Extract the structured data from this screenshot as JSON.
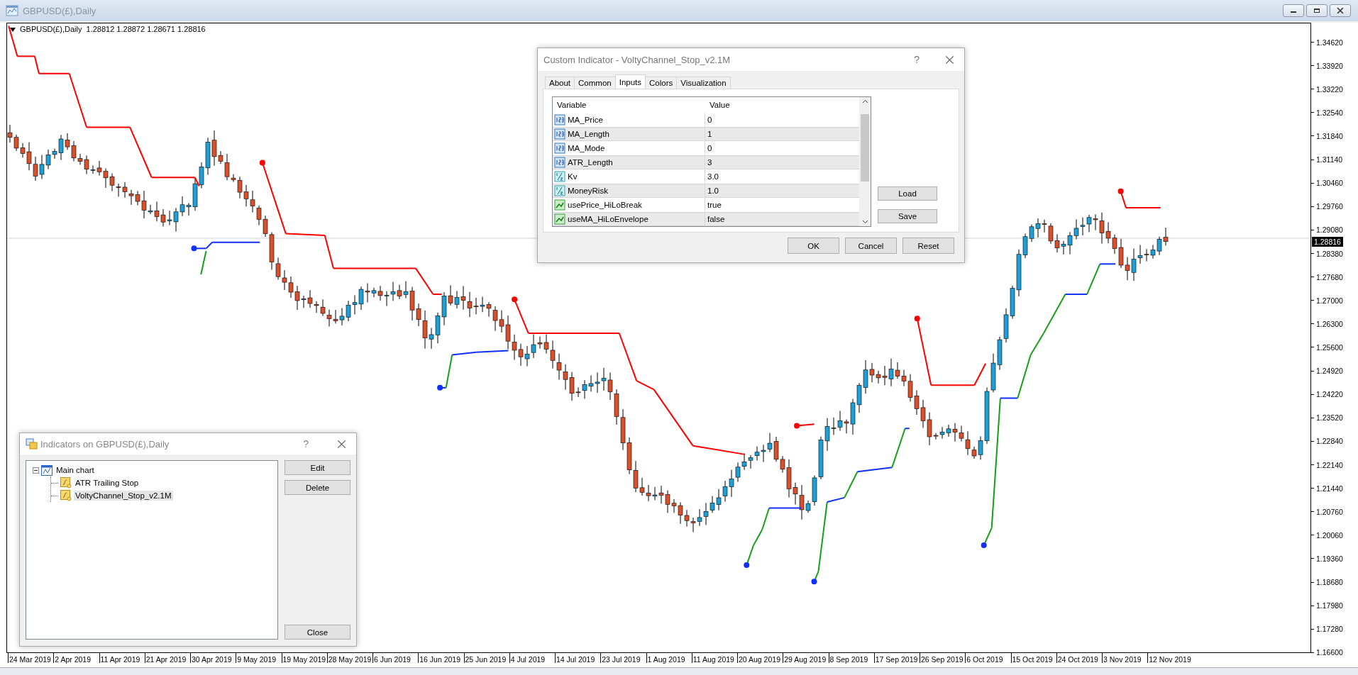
{
  "window": {
    "title": "GBPUSD(£),Daily"
  },
  "chart": {
    "header": "GBPUSD(£),Daily",
    "ohlc": [
      "1.28812",
      "1.28872",
      "1.28671",
      "1.28816"
    ],
    "price_ticks": [
      "1.34620",
      "1.33920",
      "1.33220",
      "1.32540",
      "1.31840",
      "1.31140",
      "1.30460",
      "1.29760",
      "1.29080",
      "1.28380",
      "1.27680",
      "1.27000",
      "1.26300",
      "1.25600",
      "1.24920",
      "1.24220",
      "1.23520",
      "1.22840",
      "1.22140",
      "1.21440",
      "1.20760",
      "1.20060",
      "1.19360",
      "1.18680",
      "1.17980",
      "1.17280",
      "1.16600"
    ],
    "current_price": "1.28816",
    "date_ticks": [
      "24 Mar 2019",
      "2 Apr 2019",
      "11 Apr 2019",
      "21 Apr 2019",
      "30 Apr 2019",
      "9 May 2019",
      "19 May 2019",
      "28 May 2019",
      "6 Jun 2019",
      "16 Jun 2019",
      "25 Jun 2019",
      "4 Jul 2019",
      "14 Jul 2019",
      "23 Jul 2019",
      "1 Aug 2019",
      "11 Aug 2019",
      "20 Aug 2019",
      "29 Aug 2019",
      "8 Sep 2019",
      "17 Sep 2019",
      "26 Sep 2019",
      "6 Oct 2019",
      "15 Oct 2019",
      "24 Oct 2019",
      "3 Nov 2019",
      "12 Nov 2019"
    ]
  },
  "indicator_dialog": {
    "title": "Custom Indicator - VoltyChannel_Stop_v2.1M",
    "help": "?",
    "tabs": [
      {
        "label": "About",
        "selected": false
      },
      {
        "label": "Common",
        "selected": false
      },
      {
        "label": "Inputs",
        "selected": true
      },
      {
        "label": "Colors",
        "selected": false
      },
      {
        "label": "Visualization",
        "selected": false
      }
    ],
    "columns": [
      "Variable",
      "Value"
    ],
    "rows": [
      {
        "kind": "int",
        "name": "MA_Price",
        "value": "0"
      },
      {
        "kind": "int",
        "name": "MA_Length",
        "value": "1"
      },
      {
        "kind": "int",
        "name": "MA_Mode",
        "value": "0"
      },
      {
        "kind": "int",
        "name": "ATR_Length",
        "value": "3"
      },
      {
        "kind": "double",
        "name": "Kv",
        "value": "3.0"
      },
      {
        "kind": "double",
        "name": "MoneyRisk",
        "value": "1.0"
      },
      {
        "kind": "bool",
        "name": "usePrice_HiLoBreak",
        "value": "true"
      },
      {
        "kind": "bool",
        "name": "useMA_HiLoEnvelope",
        "value": "false"
      }
    ],
    "side_buttons": [
      "Load",
      "Save"
    ],
    "buttons": [
      "OK",
      "Cancel",
      "Reset"
    ]
  },
  "indicators_window": {
    "title": "Indicators on GBPUSD(£),Daily",
    "help": "?",
    "tree": [
      {
        "label": "Main chart",
        "expanded": true,
        "children": [
          {
            "label": "ATR Trailing Stop",
            "selected": false
          },
          {
            "label": "VoltyChannel_Stop_v2.1M",
            "selected": true
          }
        ]
      }
    ],
    "buttons": [
      "Edit",
      "Delete",
      "Close"
    ]
  }
}
